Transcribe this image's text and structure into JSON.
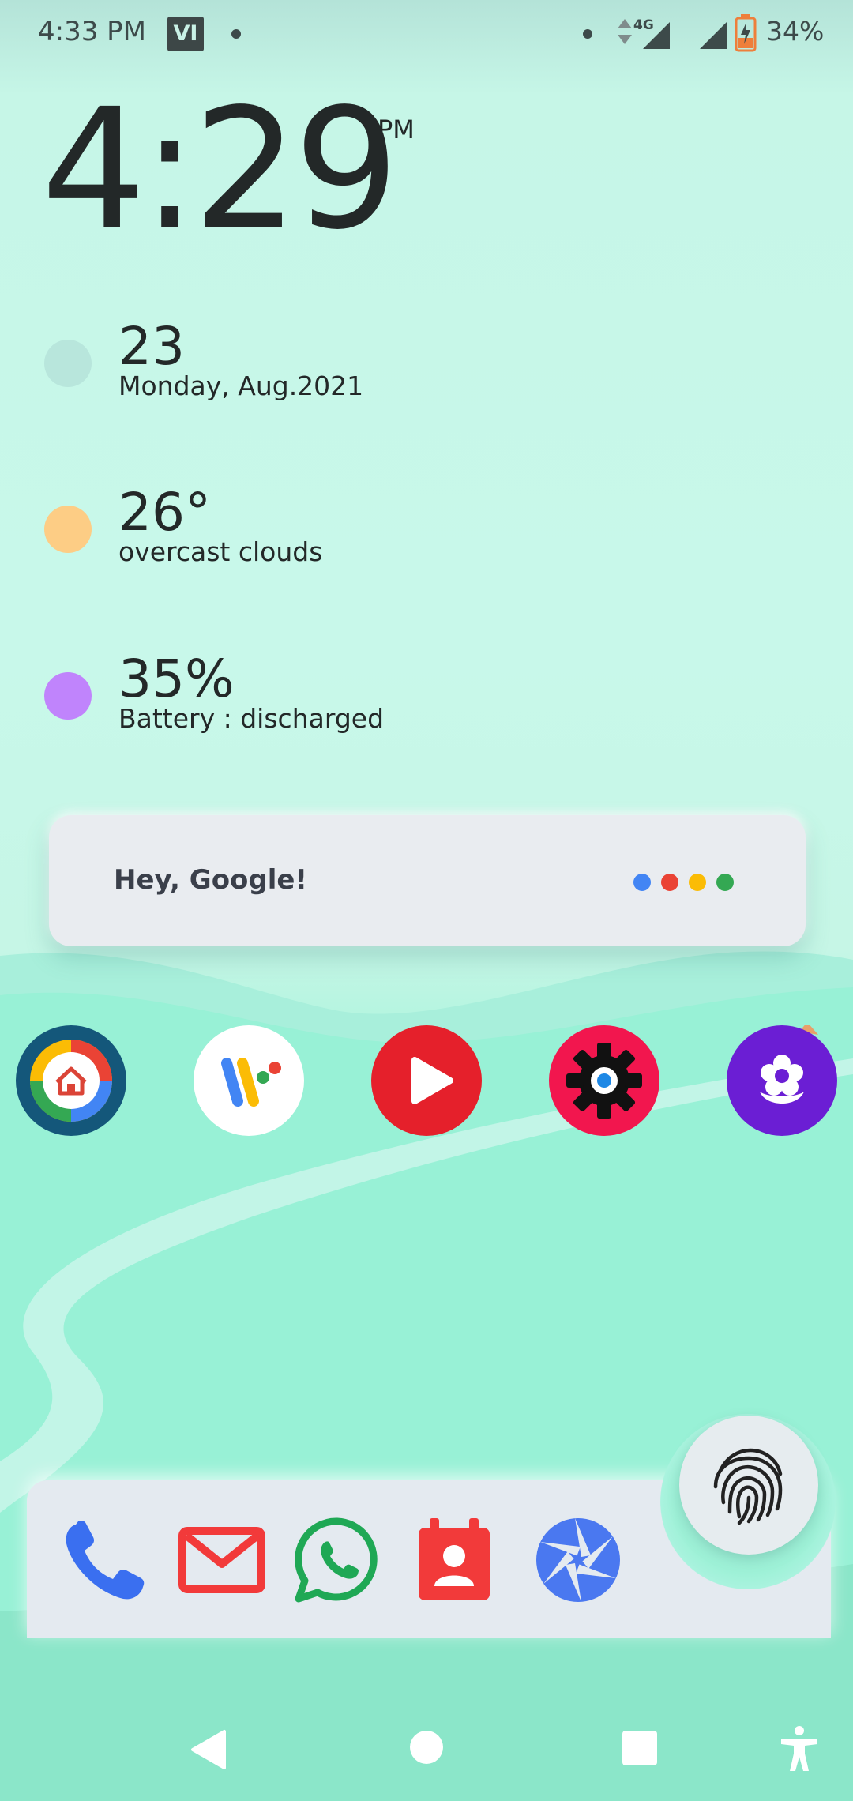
{
  "status_bar": {
    "time": "4:33 PM",
    "carrier_logo": "VI",
    "network": "4G",
    "battery": "34%"
  },
  "clock": {
    "time": "4:29",
    "ampm": "PM"
  },
  "info_rows": [
    {
      "value": "23",
      "label": "Monday, Aug.2021",
      "dot_color": "#b8e6dc"
    },
    {
      "value": "26°",
      "label": "overcast clouds",
      "dot_color": "#fdcd85"
    },
    {
      "value": "35%",
      "label": "Battery : discharged",
      "dot_color": "#c084fc"
    }
  ],
  "google_bar": {
    "text": "Hey, Google!",
    "dots": [
      "#4285f4",
      "#ea4335",
      "#fbbc05",
      "#34a853"
    ]
  },
  "apps": [
    {
      "icon": "google-home-icon"
    },
    {
      "icon": "wallet-icon"
    },
    {
      "icon": "youtube-icon"
    },
    {
      "icon": "settings-icon"
    },
    {
      "icon": "flower-icon"
    }
  ],
  "dock": [
    {
      "icon": "phone-icon"
    },
    {
      "icon": "mail-icon"
    },
    {
      "icon": "whatsapp-icon"
    },
    {
      "icon": "contacts-icon"
    },
    {
      "icon": "camera-shutter-icon"
    },
    {
      "icon": "fingerprint-icon"
    }
  ],
  "nav": [
    "back-icon",
    "home-icon",
    "recents-icon",
    "accessibility-icon"
  ]
}
